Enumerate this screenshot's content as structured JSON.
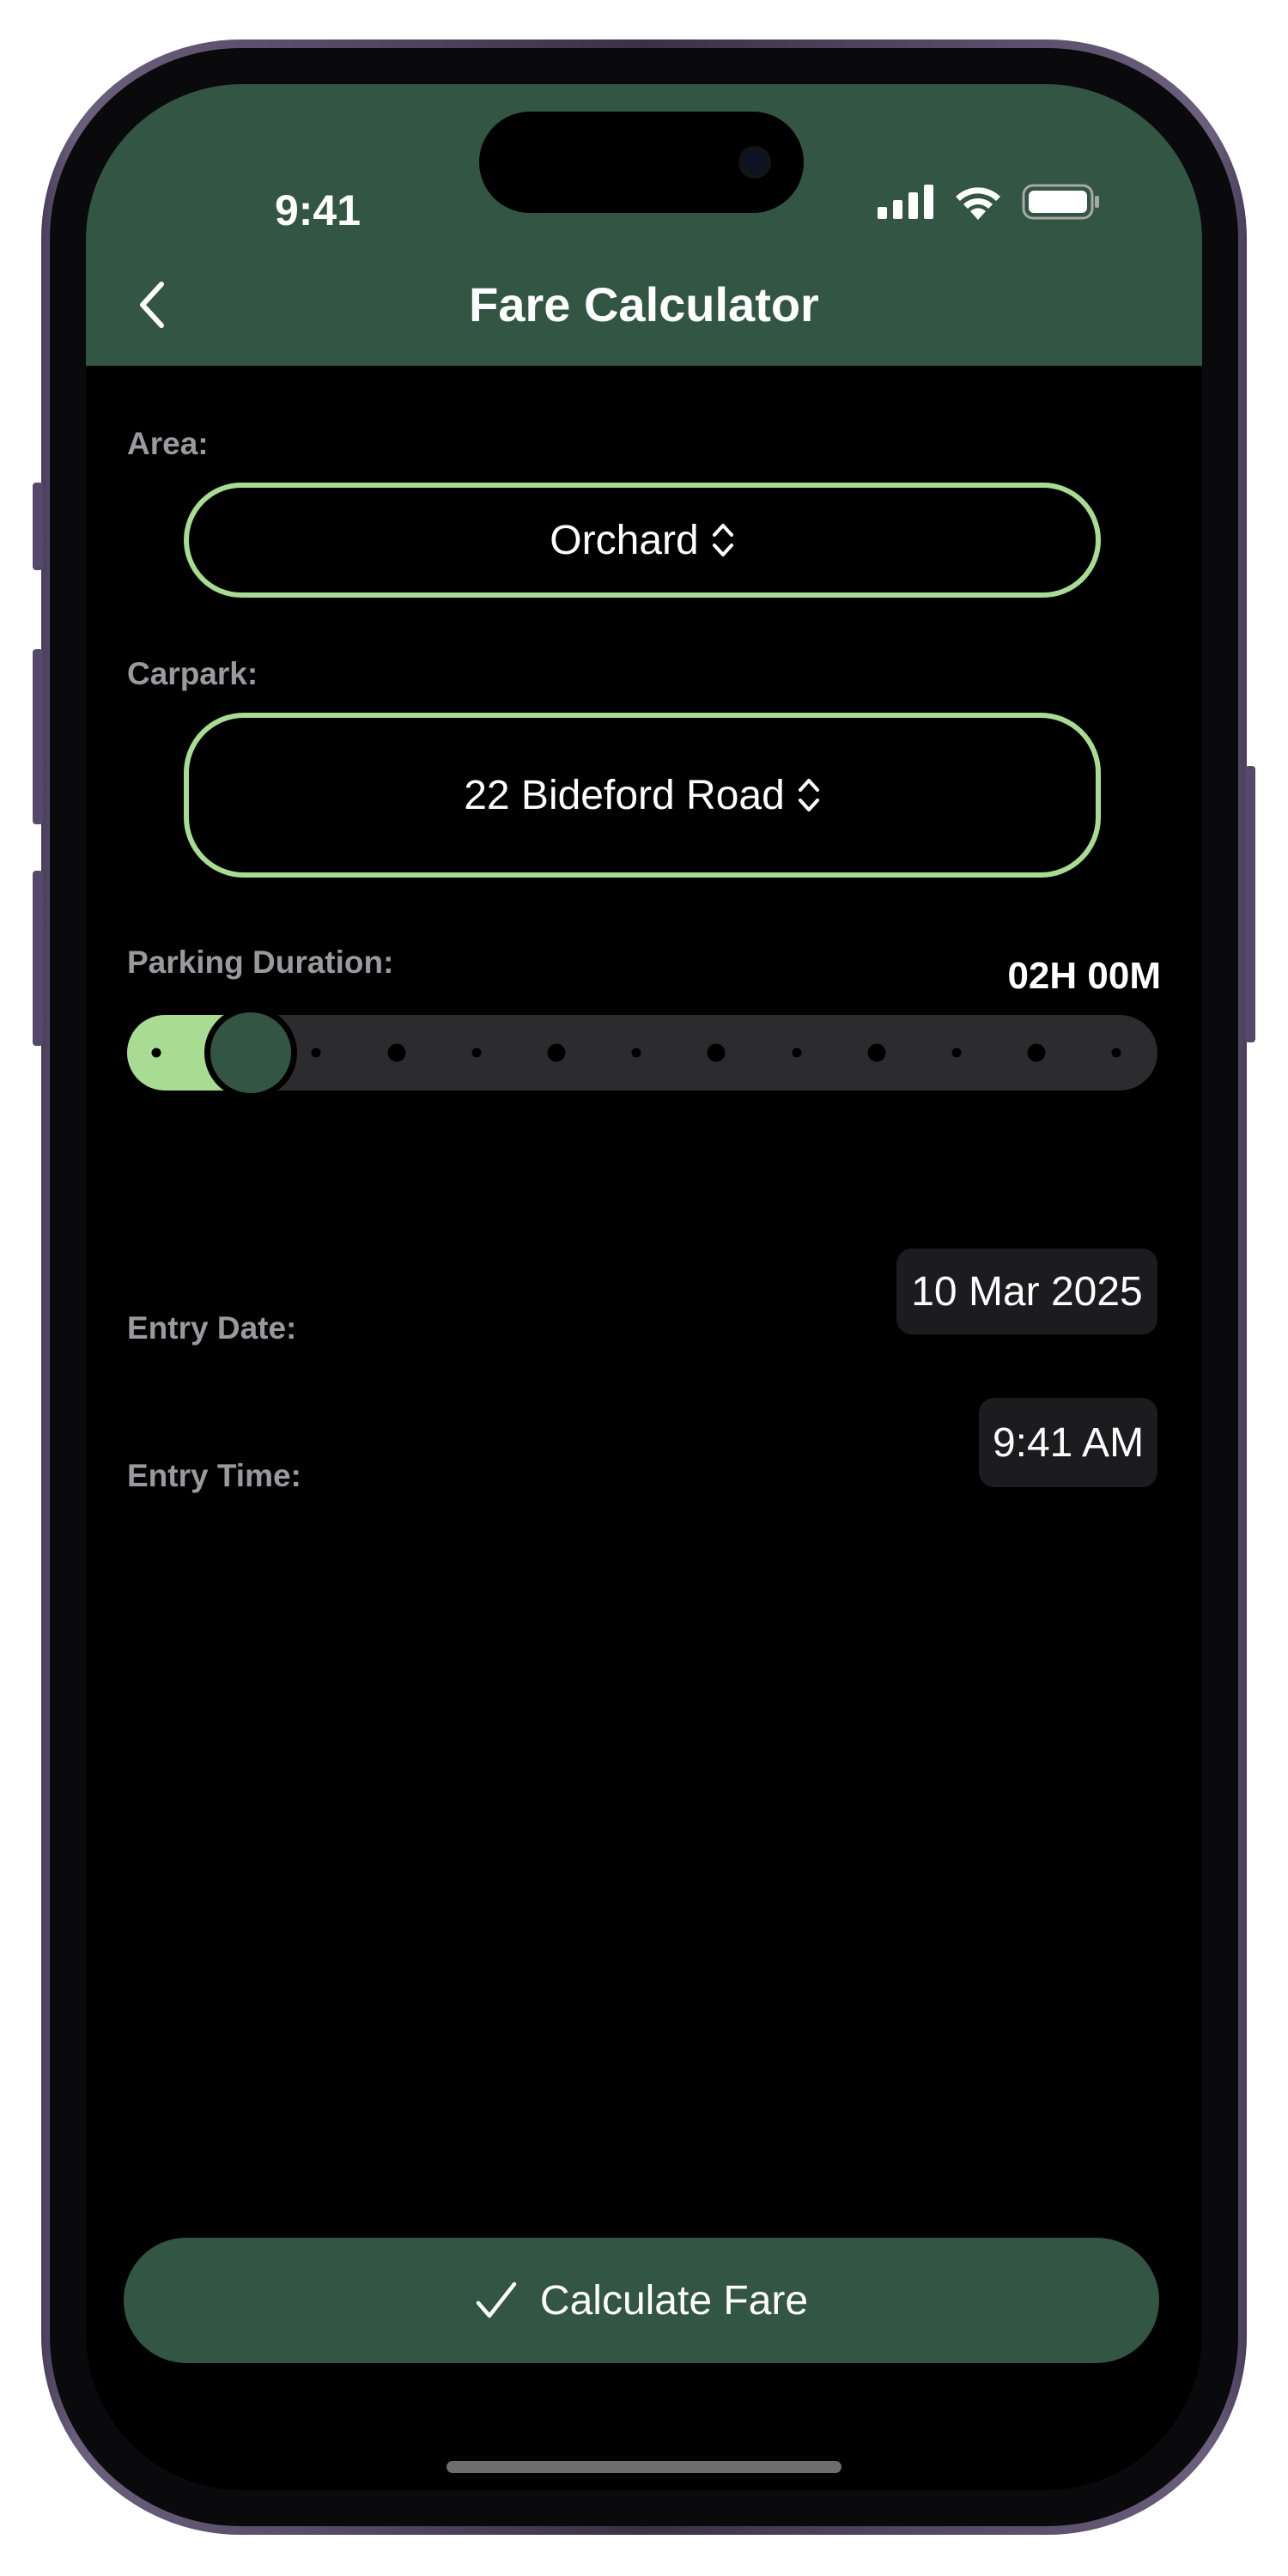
{
  "status_bar": {
    "time": "9:41",
    "icons": [
      "cellular-signal-icon",
      "wifi-icon",
      "battery-icon"
    ]
  },
  "nav": {
    "back_icon": "chevron-left-icon",
    "title": "Fare Calculator"
  },
  "form": {
    "area": {
      "label": "Area:",
      "value": "Orchard",
      "icon": "chevron-up-down-icon"
    },
    "carpark": {
      "label": "Carpark:",
      "value": "22 Bideford Road",
      "icon": "chevron-up-down-icon"
    },
    "duration": {
      "label": "Parking Duration:",
      "value": "02H 00M",
      "slider_level": 0.12
    },
    "entry_date": {
      "label": "Entry Date:",
      "value": "10 Mar 2025"
    },
    "entry_time": {
      "label": "Entry Time:",
      "value": "9:41 AM"
    }
  },
  "actions": {
    "calculate_label": "Calculate Fare",
    "calculate_icon": "checkmark-icon"
  },
  "colors": {
    "header_green": "#335544",
    "accent_light_green": "#a8dc92",
    "background": "#000000",
    "label_gray": "#9a9a9e",
    "field_dark": "#1c1c1e"
  }
}
